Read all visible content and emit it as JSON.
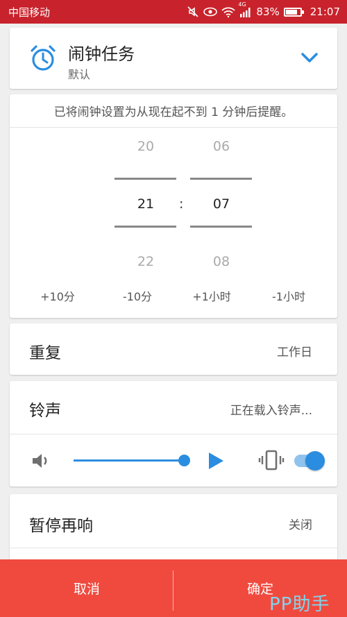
{
  "status_bar": {
    "carrier": "中国移动",
    "network_badge": "4G",
    "battery": "83%",
    "time": "21:07",
    "icons": [
      "mute-icon",
      "eye-icon",
      "wifi-icon",
      "signal-icon",
      "battery-icon"
    ]
  },
  "task": {
    "title": "闹钟任务",
    "subtitle": "默认",
    "icon": "alarm-clock-icon",
    "accent": "#2b8de0"
  },
  "picker": {
    "notice": "已将闹钟设置为从现在起不到 1 分钟后提醒。",
    "hours": {
      "prev": "20",
      "current": "21",
      "next": "22"
    },
    "minutes": {
      "prev": "06",
      "current": "07",
      "next": "08"
    },
    "separator": ":",
    "quick_buttons": [
      "+10分",
      "-10分",
      "+1小时",
      "-1小时"
    ]
  },
  "repeat": {
    "label": "重复",
    "value": "工作日"
  },
  "ringtone": {
    "label": "铃声",
    "value": "正在载入铃声...",
    "volume_level": 1.0,
    "vibrate_enabled": true
  },
  "snooze": {
    "label": "暂停再响",
    "value": "关闭"
  },
  "actions": {
    "cancel": "取消",
    "confirm": "确定",
    "bar_color": "#f04a3f"
  },
  "watermark": "PP助手"
}
